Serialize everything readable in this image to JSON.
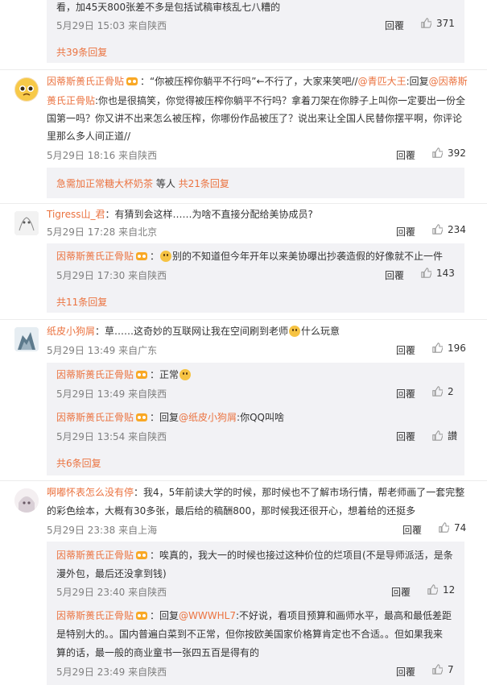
{
  "c0": {
    "text_tail": "看，加45天800张差不多是包括试稿审核乱七八糟的",
    "time": "5月29日 15:03",
    "loc": "来自陕西",
    "reply": "回覆",
    "likes": "371",
    "more": "共39条回复"
  },
  "c1": {
    "user": "因蒂斯蒉氏正骨贴",
    "line1a": "：“你被压榨你躺平不行吗”←不行了，大家来笑吧//",
    "m1": "@青匹大王",
    "line1b": ":回复",
    "m2": "@因蒂斯",
    "line2a": "蒉氏正骨贴",
    "line2b": ":你也是很搞笑，你觉得被压榨你躺平不行吗？拿着刀架在你脖子上叫你一定要出一份全",
    "line3": "国第一吗？你又讲不出来怎么被压榨，你哪份作品被压了？说出来让全国人民替你摆平啊，你评论",
    "line4": "里那么多人间正道//",
    "time": "5月29日 18:16",
    "loc": "来自陕西",
    "reply": "回覆",
    "likes": "392",
    "sub_user": "急需加正常糖大杯奶茶",
    "sub_mid": " 等人 ",
    "more": "共21条回复"
  },
  "c2": {
    "user": "Tigress山_君",
    "text": "：有猜到会这样……为啥不直接分配给美协成员?",
    "time": "5月29日 17:28",
    "loc": "来自北京",
    "reply": "回覆",
    "likes": "234",
    "r1_user": "因蒂斯蒉氏正骨贴",
    "r1_text": "别的不知道但今年开年以来美协曝出抄袭造假的好像就不止一件",
    "r1_time": "5月29日 17:30",
    "r1_loc": "来自陕西",
    "r1_reply": "回覆",
    "r1_likes": "143",
    "more": "共11条回复"
  },
  "c3": {
    "user": "纸皮小狗屑",
    "text_a": "：草……这奇妙的互联网让我在空间刷到老师",
    "text_b": "什么玩意",
    "time": "5月29日 13:49",
    "loc": "来自广东",
    "reply": "回覆",
    "likes": "196",
    "r1_user": "因蒂斯蒉氏正骨贴",
    "r1_text": "：正常",
    "r1_time": "5月29日 13:49",
    "r1_loc": "来自陕西",
    "r1_reply": "回覆",
    "r1_likes": "2",
    "r2_user": "因蒂斯蒉氏正骨贴",
    "r2_pre": "：回复",
    "r2_mention": "@纸皮小狗屑",
    "r2_text": ":你QQ叫啥",
    "r2_time": "5月29日 13:54",
    "r2_loc": "来自陕西",
    "r2_reply": "回覆",
    "r2_likes": "讃",
    "more": "共6条回复"
  },
  "c4": {
    "user": "啊嘟怀表怎么没有停",
    "line1": "：我4，5年前读大学的时候，那时候也不了解市场行情，帮老师画了一套完整",
    "line2": "的彩色绘本，大概有30多张，最后给的稿酬800，那时候我还很开心，想着给的还挺多",
    "time": "5月29日 23:38",
    "loc": "来自上海",
    "reply": "回覆",
    "likes": "74",
    "r1_user": "因蒂斯蒉氏正骨贴",
    "r1_line1": "：唉真的，我大一的时候也接过这种价位的烂项目(不是导师派活，是条",
    "r1_line2": "漫外包，最后还没拿到钱)",
    "r1_time": "5月29日 23:40",
    "r1_loc": "来自陕西",
    "r1_reply": "回覆",
    "r1_likes": "12",
    "r2_user": "因蒂斯蒉氏正骨贴",
    "r2_pre": "：回复",
    "r2_mention": "@WWWHL7",
    "r2_line1": ":不好说，看项目预算和画师水平，最高和最低差距",
    "r2_line2": "是特别大的。。国内普遍白菜到不正常，但你按欧美国家价格算肯定也不合适。。但如果我来",
    "r2_line3": "算的话，最一般的商业童书一张四五百是得有的",
    "r2_time": "5月29日 23:49",
    "r2_loc": "来自陕西",
    "r2_reply": "回覆",
    "r2_likes": "7"
  }
}
